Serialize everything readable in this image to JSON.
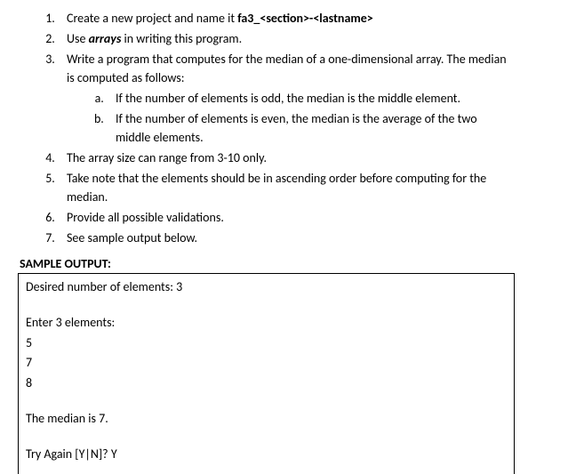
{
  "list": {
    "item1_pre": "Create a new project and name it ",
    "item1_bold": "fa3_<section>-<lastname>",
    "item2_pre": "Use ",
    "item2_bi": "arrays",
    "item2_post": " in writing this program.",
    "item3": "Write a program that computes for the median of a one-dimensional array. The median is computed as follows:",
    "item3a": "If the number of elements is odd, the median is the middle element.",
    "item3b": "If the number of elements is even, the median is the average of the two middle elements.",
    "item4": "The array size can range from 3-10 only.",
    "item5": "Take note that the elements should be in ascending order before computing for the median.",
    "item6": "Provide all possible validations.",
    "item7": "See sample output below."
  },
  "sample_header": "SAMPLE OUTPUT:",
  "output": {
    "line1": "Desired number of elements: 3",
    "line2": "Enter 3 elements:",
    "line3": "5",
    "line4": "7",
    "line5": "8",
    "line6": "The median is 7.",
    "line7": "Try Again [Y|N]? Y"
  }
}
